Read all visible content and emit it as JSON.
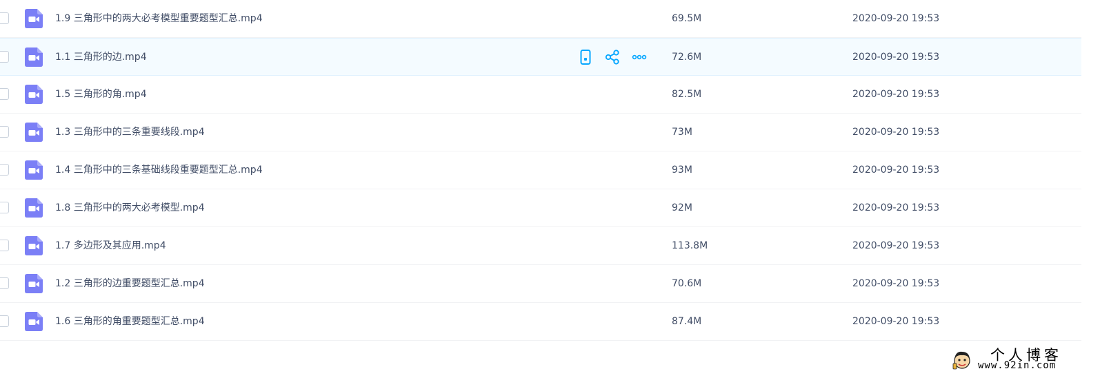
{
  "files": [
    {
      "name": "1.9 三角形中的两大必考模型重要题型汇总.mp4",
      "size": "69.5M",
      "date": "2020-09-20 19:53",
      "hovered": false
    },
    {
      "name": "1.1 三角形的边.mp4",
      "size": "72.6M",
      "date": "2020-09-20 19:53",
      "hovered": true
    },
    {
      "name": "1.5 三角形的角.mp4",
      "size": "82.5M",
      "date": "2020-09-20 19:53",
      "hovered": false
    },
    {
      "name": "1.3 三角形中的三条重要线段.mp4",
      "size": "73M",
      "date": "2020-09-20 19:53",
      "hovered": false
    },
    {
      "name": "1.4 三角形中的三条基础线段重要题型汇总.mp4",
      "size": "93M",
      "date": "2020-09-20 19:53",
      "hovered": false
    },
    {
      "name": "1.8 三角形中的两大必考模型.mp4",
      "size": "92M",
      "date": "2020-09-20 19:53",
      "hovered": false
    },
    {
      "name": "1.7 多边形及其应用.mp4",
      "size": "113.8M",
      "date": "2020-09-20 19:53",
      "hovered": false
    },
    {
      "name": "1.2 三角形的边重要题型汇总.mp4",
      "size": "70.6M",
      "date": "2020-09-20 19:53",
      "hovered": false
    },
    {
      "name": "1.6 三角形的角重要题型汇总.mp4",
      "size": "87.4M",
      "date": "2020-09-20 19:53",
      "hovered": false
    }
  ],
  "row_actions": [
    {
      "icon": "phone-icon",
      "name": "send-to-phone-button"
    },
    {
      "icon": "share-icon",
      "name": "share-button"
    },
    {
      "icon": "more-icon",
      "name": "more-button"
    }
  ],
  "watermark": {
    "line1": "个人博客",
    "line2": "www.92in.com",
    "logo_icon": "cartoon-face-icon"
  },
  "colors": {
    "file_icon": "#7b7ff6",
    "action_icon": "#06a7ff",
    "hover_row_bg": "#f4fbff",
    "text": "#424e67"
  }
}
